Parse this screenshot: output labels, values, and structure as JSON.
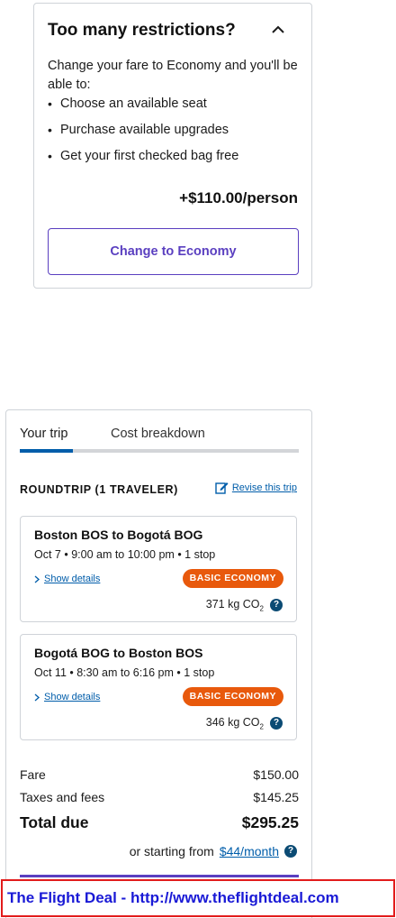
{
  "restrictions": {
    "title": "Too many restrictions?",
    "description": "Change your fare to Economy and you'll be able to:",
    "benefits": [
      "Choose an available seat",
      "Purchase available upgrades",
      "Get your first checked bag free"
    ],
    "price": "+$110.00/person",
    "button_label": "Change to Economy"
  },
  "trip": {
    "tabs": [
      "Your trip",
      "Cost breakdown"
    ],
    "active_tab": "Your trip",
    "heading": "ROUNDTRIP (1 TRAVELER)",
    "revise_label": "Revise this trip",
    "flights": [
      {
        "route": "Boston BOS to Bogotá BOG",
        "times": "Oct 7 • 9:00 am to 10:00 pm • 1 stop",
        "details_label": "Show details",
        "fare_class": "BASIC ECONOMY",
        "co2_value": "371 kg CO",
        "co2_sub": "2"
      },
      {
        "route": "Bogotá BOG to Boston BOS",
        "times": "Oct 11 • 8:30 am to 6:16 pm • 1 stop",
        "details_label": "Show details",
        "fare_class": "BASIC ECONOMY",
        "co2_value": "346 kg CO",
        "co2_sub": "2"
      }
    ],
    "costs": {
      "fare_label": "Fare",
      "fare_value": "$150.00",
      "taxes_label": "Taxes and fees",
      "taxes_value": "$145.25",
      "total_label": "Total due",
      "total_value": "$295.25",
      "starting_prefix": "or starting from",
      "monthly": "$44/month"
    }
  },
  "watermark": "The Flight Deal - http://www.theflightdeal.com",
  "colors": {
    "link": "#005daa",
    "accent_purple": "#5a3fc0",
    "badge_orange": "#e8590c",
    "info_navy": "#0b4b74",
    "watermark_red": "#e21b1b",
    "watermark_blue": "#1a1ad6"
  },
  "icons": {
    "collapse": "chevron-up-icon",
    "revise": "edit-icon",
    "details": "chevron-right-icon",
    "info": "info-icon"
  }
}
